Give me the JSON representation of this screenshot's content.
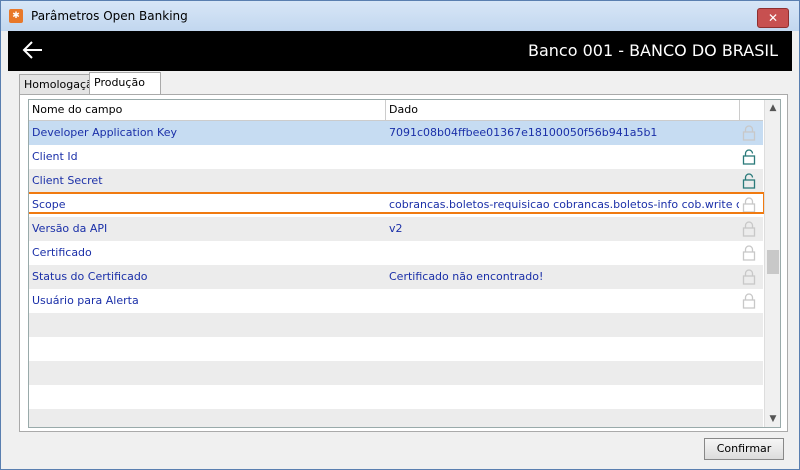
{
  "window": {
    "title": "Parâmetros Open Banking",
    "close_symbol": "✕"
  },
  "header": {
    "bank_title": "Banco 001 - BANCO DO BRASIL"
  },
  "tabs": [
    {
      "label": "Homologação",
      "active": false
    },
    {
      "label": "Produção",
      "active": true
    }
  ],
  "grid": {
    "columns": [
      "Nome do campo",
      "Dado"
    ],
    "rows": [
      {
        "name": "Developer Application Key",
        "value": "7091c08b04ffbee01367e18100050f56b941a5b1",
        "locked": false,
        "selected": true
      },
      {
        "name": "Client Id",
        "value": "",
        "locked": true
      },
      {
        "name": "Client Secret",
        "value": "",
        "locked": true
      },
      {
        "name": "Scope",
        "value": "cobrancas.boletos-requisicao cobrancas.boletos-info cob.write cob.read pix.re",
        "locked": false,
        "highlighted": true
      },
      {
        "name": "Versão da API",
        "value": "v2",
        "locked": false
      },
      {
        "name": "Certificado",
        "value": "",
        "locked": false
      },
      {
        "name": "Status do Certificado",
        "value": "Certificado não encontrado!",
        "locked": false
      },
      {
        "name": "Usuário para Alerta",
        "value": "",
        "locked": false
      }
    ]
  },
  "buttons": {
    "confirm": "Confirmar"
  },
  "colors": {
    "header_bg": "#000000",
    "link_text": "#1a2fa8",
    "selected_row": "#c6dcf2",
    "highlight_border": "#f07a10",
    "lock_active": "#2a7a7a",
    "lock_inactive": "#c8c8c8"
  }
}
